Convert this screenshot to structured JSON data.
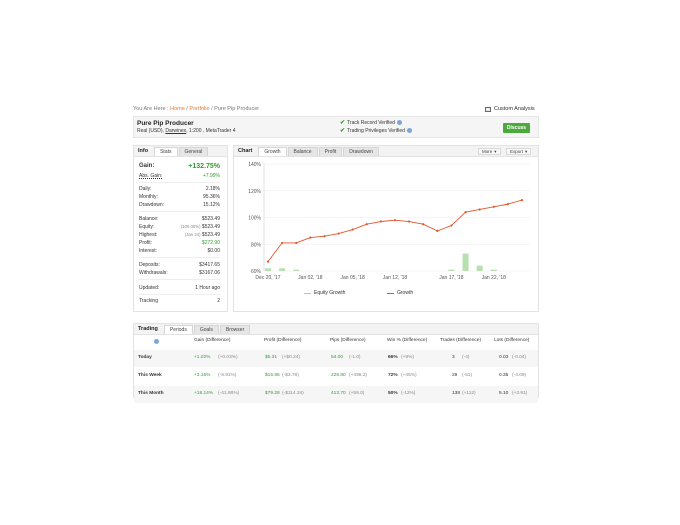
{
  "breadcrumb": {
    "prefix": "You Are Here :",
    "home": "Home",
    "portfolio": "Portfolio",
    "current": "Pure Pip Producer",
    "sep": "/"
  },
  "custom_analysis": "Custom Analysis",
  "header": {
    "title": "Pure Pip Producer",
    "sub_prefix": "Real (USD),",
    "broker": "Darwinex",
    "sub_suffix": ", 1:200 , MetaTrader 4",
    "track_record": "Track Record Verified",
    "trading_privileges": "Trading Privileges Verified",
    "discuss": "Discuss"
  },
  "info_panel": {
    "tab_title": "Info",
    "tabs": [
      "Stats",
      "General"
    ],
    "gain_label": "Gain:",
    "gain_value": "+132.75%",
    "abs_gain_label": "Abs. Gain:",
    "abs_gain_value": "+7.99%",
    "daily_label": "Daily:",
    "daily_value": "2.18%",
    "monthly_label": "Monthly:",
    "monthly_value": "95.36%",
    "drawdown_label": "Drawdown:",
    "drawdown_value": "15.12%",
    "balance_label": "Balance:",
    "balance_value": "$523.49",
    "equity_label": "Equity:",
    "equity_pct": "(100.00%)",
    "equity_value": "$523.49",
    "highest_label": "Highest:",
    "highest_date": "(Jan 24)",
    "highest_value": "$523.49",
    "profit_label": "Profit:",
    "profit_value": "$272.90",
    "interest_label": "Interest:",
    "interest_value": "$0.00",
    "deposits_label": "Deposits:",
    "deposits_value": "$3417.65",
    "withdrawals_label": "Withdrawals:",
    "withdrawals_value": "$3167.06",
    "updated_label": "Updated:",
    "updated_value": "1 Hour ago",
    "tracking_label": "Tracking",
    "tracking_value": "2"
  },
  "chart_panel": {
    "tab_title": "Chart",
    "tabs": [
      "Growth",
      "Balance",
      "Profit",
      "Drawdown"
    ],
    "more": "More",
    "export": "Export"
  },
  "chart_data": {
    "type": "line",
    "y_ticks": [
      "140%",
      "120%",
      "100%",
      "80%",
      "60%"
    ],
    "ylim": [
      60,
      140
    ],
    "x_ticks": [
      "Dec 20, '17",
      "Jan 02, '18",
      "Jan 05, '18",
      "Jan 12, '18",
      "Jan 17, '18",
      "Jan 22, '18"
    ],
    "growth": [
      67,
      81,
      81,
      85,
      86,
      88,
      91,
      95,
      97,
      98,
      97,
      95,
      90,
      94,
      104,
      106,
      108,
      110,
      113
    ],
    "equity_growth_bars": [
      62,
      62,
      61,
      60,
      60,
      60,
      60,
      60,
      60,
      60,
      60,
      60,
      60,
      61,
      73,
      64,
      61,
      60,
      60
    ],
    "legend": [
      "Equity Growth",
      "Growth"
    ],
    "colors": {
      "growth": "#e2552c",
      "equity": "#b8e0b0",
      "equity_legend": "#f0c040",
      "grid": "#ececec"
    }
  },
  "periods_panel": {
    "tabs": [
      "Trading",
      "Periods",
      "Goals",
      "Browser"
    ],
    "headers": [
      "Gain (Difference)",
      "Profit (Difference)",
      "Pips (Difference)",
      "Win % (Difference)",
      "Trades (Difference)",
      "Lots (Difference)"
    ],
    "rows": [
      {
        "label": "Today",
        "gain": "+1.02%",
        "gain_diff": "(+0.03%)",
        "profit": "$5.31",
        "profit_diff": "(+$0.24)",
        "pips": "54.00",
        "pips_diff": "(-1.0)",
        "win": "66%",
        "win_diff": "(+9%)",
        "trades": "3",
        "trades_diff": "(-4)",
        "lots": "0.03",
        "lots_diff": "(-0.04)"
      },
      {
        "label": "This Week",
        "gain": "+3.15%",
        "gain_diff": "(-8.91%)",
        "profit": "$15.95",
        "profit_diff": "(-$3.78)",
        "pips": "226.80",
        "pips_diff": "(+498.2)",
        "win": "72%",
        "win_diff": "(+45%)",
        "trades": "29",
        "trades_diff": "(-51)",
        "lots": "0.35",
        "lots_diff": "(-4.09)"
      },
      {
        "label": "This Month",
        "gain": "+18.14%",
        "gain_diff": "(-41.88%)",
        "profit": "$79.28",
        "profit_diff": "(-$114.34)",
        "pips": "413.70",
        "pips_diff": "(+59.0)",
        "win": "50%",
        "win_diff": "(-12%)",
        "trades": "138",
        "trades_diff": "(+112)",
        "lots": "5.10",
        "lots_diff": "(+3.91)"
      }
    ]
  }
}
